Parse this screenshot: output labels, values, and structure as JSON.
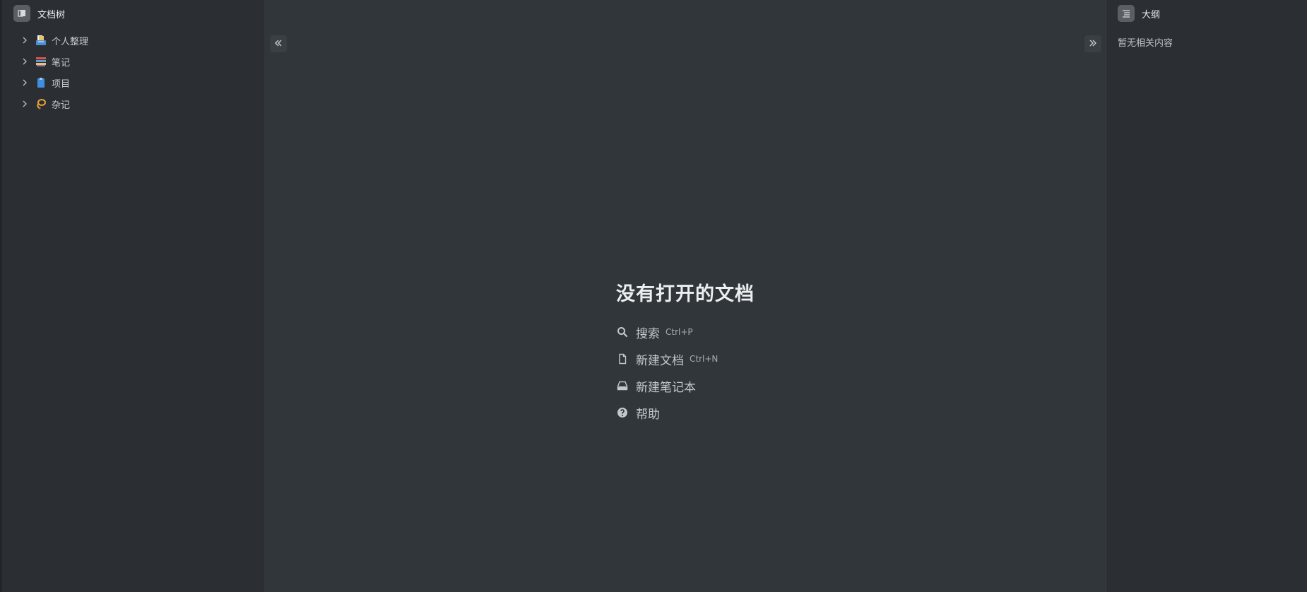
{
  "left_panel": {
    "title": "文档树",
    "icon": "docs-stack-icon",
    "items": [
      {
        "label": "个人整理",
        "icon": "inbox-tray-emoji"
      },
      {
        "label": "笔记",
        "icon": "books-emoji"
      },
      {
        "label": "项目",
        "icon": "clipboard-emoji"
      },
      {
        "label": "杂记",
        "icon": "lasso-emoji"
      }
    ]
  },
  "main": {
    "empty_title": "没有打开的文档",
    "actions": [
      {
        "label": "搜索",
        "shortcut": "Ctrl+P",
        "icon": "search-icon"
      },
      {
        "label": "新建文档",
        "shortcut": "Ctrl+N",
        "icon": "file-icon"
      },
      {
        "label": "新建笔记本",
        "shortcut": "",
        "icon": "inbox-icon"
      },
      {
        "label": "帮助",
        "shortcut": "",
        "icon": "help-icon"
      }
    ]
  },
  "right_panel": {
    "title": "大纲",
    "icon": "outline-list-icon",
    "empty_text": "暂无相关内容"
  },
  "colors": {
    "background": "#30353a",
    "sidebar": "#2b2f33",
    "text": "#c8ccd0"
  }
}
